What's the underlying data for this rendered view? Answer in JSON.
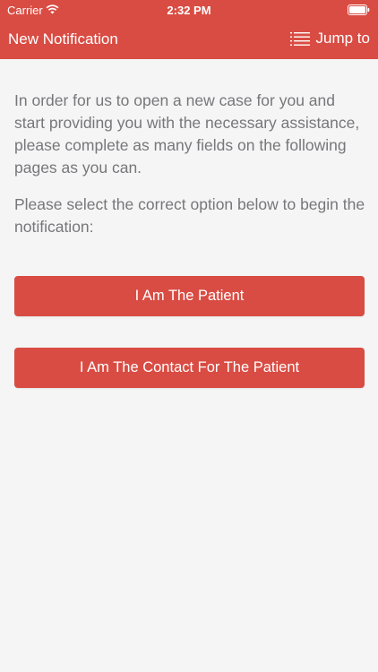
{
  "status_bar": {
    "carrier": "Carrier",
    "time": "2:32 PM",
    "wifi_icon": "wifi-icon",
    "battery_icon": "battery-icon"
  },
  "nav_bar": {
    "title": "New Notification",
    "jump_to_label": "Jump to",
    "jump_to_icon": "list-icon"
  },
  "main": {
    "intro_text": "In order for us to open a new case for you and start providing you with the necessary assistance, please complete as many fields on the following pages as you can.",
    "select_text": "Please select the correct option below to begin the notification:"
  },
  "options": {
    "patient_label": "I Am The Patient",
    "contact_label": "I Am The Contact For The Patient"
  },
  "colors": {
    "accent": "#d94c43",
    "background": "#f5f5f5",
    "body_text": "#77777b"
  }
}
